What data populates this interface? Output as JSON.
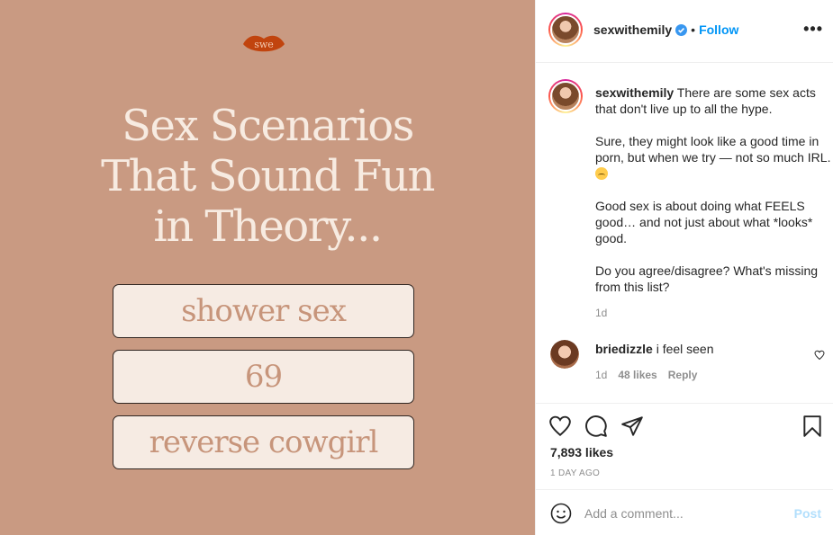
{
  "post": {
    "logo_text": "swe",
    "headline_lines": [
      "Sex Scenarios",
      "That Sound Fun",
      "in Theory..."
    ],
    "scenarios": [
      "shower sex",
      "69",
      "reverse cowgirl"
    ],
    "colors": {
      "background": "#c99a82",
      "pill": "#f6ebe3",
      "pill_text": "#c7957b",
      "logo": "#c1440e"
    }
  },
  "header": {
    "username": "sexwithemily",
    "separator": "•",
    "follow_label": "Follow",
    "more_label": "•••",
    "verified_icon": "verified-badge-icon"
  },
  "caption": {
    "username": "sexwithemily",
    "paragraphs": [
      "There are some sex acts that don't live up to all the hype.",
      "Sure, they might look like a good time in porn, but when we try — not so much IRL.",
      "Good sex is about doing what FEELS good… and not just about what *looks* good.",
      "Do you agree/disagree? What's missing from this list?"
    ],
    "time": "1d"
  },
  "comment": {
    "username": "briedizzle",
    "text": "i feel seen",
    "time": "1d",
    "likes": "48 likes",
    "reply_label": "Reply"
  },
  "actions": {
    "likes": "7,893 likes",
    "time_ago": "1 DAY AGO"
  },
  "add_comment": {
    "placeholder": "Add a comment...",
    "post_label": "Post"
  }
}
